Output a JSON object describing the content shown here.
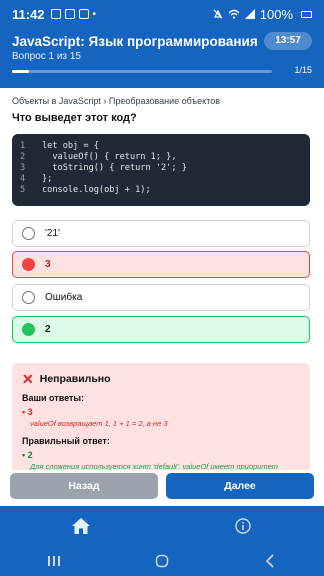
{
  "status_bar": {
    "time": "11:42",
    "battery": "100%"
  },
  "header": {
    "title": "JavaScript: Язык программирования",
    "subtitle": "Вопрос 1 из 15",
    "timer": "13:57",
    "progress_label": "1/15",
    "progress_fraction": 0.067
  },
  "breadcrumb": "Объекты в JavaScript › Преобразование объектов",
  "question": "Что выведет этот код?",
  "code": {
    "lines": [
      {
        "num": "1",
        "text": "let obj = {"
      },
      {
        "num": "2",
        "text": "  valueOf() { return 1; },"
      },
      {
        "num": "3",
        "text": "  toString() { return '2'; }"
      },
      {
        "num": "4",
        "text": "};"
      },
      {
        "num": "5",
        "text": "console.log(obj + 1);"
      }
    ]
  },
  "options": [
    {
      "label": "'21'",
      "state": "default"
    },
    {
      "label": "3",
      "state": "wrong"
    },
    {
      "label": "Ошибка",
      "state": "default"
    },
    {
      "label": "2",
      "state": "correct"
    }
  ],
  "feedback": {
    "title": "Неправильно",
    "your_answers_label": "Ваши ответы:",
    "your_answer": "• 3",
    "your_answer_explanation": "valueOf возвращает 1, 1 + 1 = 2, а не 3",
    "correct_label": "Правильный ответ:",
    "correct_answer": "• 2",
    "correct_explanation": "Для сложения используется хинт 'default'. valueOf имеет приоритет"
  },
  "buttons": {
    "back": "Назад",
    "next": "Далее"
  },
  "colors": {
    "primary": "#1565c0",
    "wrong": "#ef4444",
    "correct": "#22c55e"
  },
  "tabs": [
    {
      "icon": "home-icon"
    },
    {
      "icon": "info-icon"
    }
  ]
}
